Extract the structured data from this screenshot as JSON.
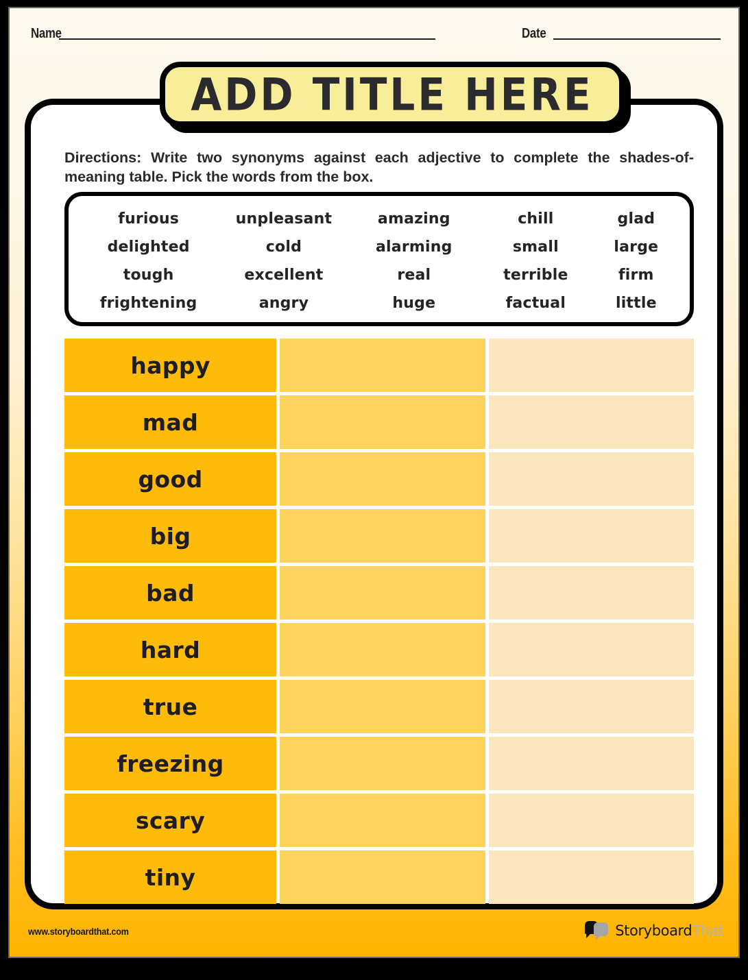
{
  "worksheet": {
    "name_label": "Name",
    "date_label": "Date",
    "title": "ADD TITLE HERE",
    "directions": "Directions: Write two synonyms against each adjective to complete the shades-of-meaning table. Pick the words from the box."
  },
  "word_bank": {
    "rows": [
      [
        "furious",
        "unpleasant",
        "amazing",
        "chill",
        "glad"
      ],
      [
        "delighted",
        "cold",
        "alarming",
        "small",
        "large"
      ],
      [
        "tough",
        "excellent",
        "real",
        "terrible",
        "firm"
      ],
      [
        "frightening",
        "angry",
        "huge",
        "factual",
        "little"
      ]
    ]
  },
  "table": {
    "rows": [
      {
        "word": "happy",
        "synonym_1": "",
        "synonym_2": ""
      },
      {
        "word": "mad",
        "synonym_1": "",
        "synonym_2": ""
      },
      {
        "word": "good",
        "synonym_1": "",
        "synonym_2": ""
      },
      {
        "word": "big",
        "synonym_1": "",
        "synonym_2": ""
      },
      {
        "word": "bad",
        "synonym_1": "",
        "synonym_2": ""
      },
      {
        "word": "hard",
        "synonym_1": "",
        "synonym_2": ""
      },
      {
        "word": "true",
        "synonym_1": "",
        "synonym_2": ""
      },
      {
        "word": "freezing",
        "synonym_1": "",
        "synonym_2": ""
      },
      {
        "word": "scary",
        "synonym_1": "",
        "synonym_2": ""
      },
      {
        "word": "tiny",
        "synonym_1": "",
        "synonym_2": ""
      }
    ]
  },
  "footer": {
    "url": "www.storyboardthat.com",
    "brand_primary": "Storyboard",
    "brand_secondary": "That",
    "logo_icon": "speech-bubbles-icon"
  },
  "colors": {
    "page_top": "#FDF9EE",
    "page_bottom": "#FFB400",
    "title_banner": "#F8EE9A",
    "column_1": "#FFBB09",
    "column_2": "#FFD45E",
    "column_3": "#F9E6BC",
    "ink": "#1e1e22"
  }
}
